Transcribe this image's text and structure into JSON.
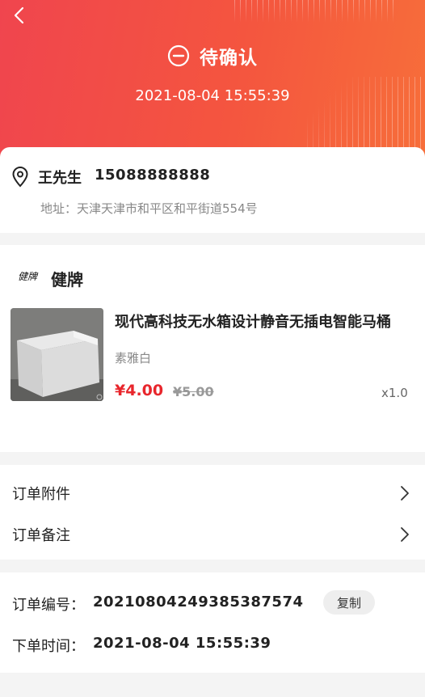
{
  "header": {
    "status_text": "待确认",
    "status_time": "2021-08-04 15:55:39"
  },
  "address": {
    "name": "王先生",
    "phone": "15088888888",
    "line": "地址：天津天津市和平区和平街道554号"
  },
  "shop": {
    "logo_text": "健牌",
    "name": "健牌"
  },
  "goods": {
    "title": "现代高科技无水箱设计静音无插电智能马桶",
    "spec": "素雅白",
    "price": "¥4.00",
    "original_price": "¥5.00",
    "quantity": "x1.0"
  },
  "extras": {
    "attachments_label": "订单附件",
    "remarks_label": "订单备注"
  },
  "order_info": {
    "number_label": "订单编号：",
    "number_value": "2021080424938538 7574",
    "copy_label": "复制",
    "time_label": "下单时间：",
    "time_value": "2021-08-04 15:55:39"
  },
  "colors": {
    "accent": "#f4553f",
    "price": "#e8262c"
  }
}
